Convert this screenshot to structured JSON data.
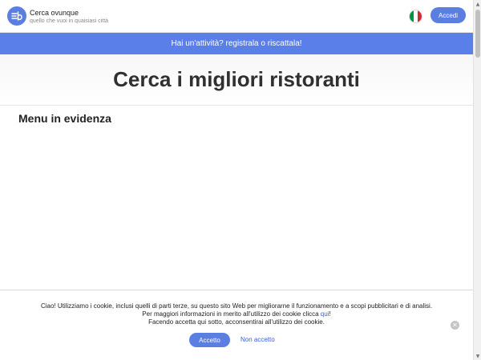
{
  "header": {
    "logo_icon": "fork-knife-logo-icon",
    "search_title": "Cerca ovunque",
    "search_subtitle": "quello che vuoi in quaisiasi città",
    "language_flag": "italy-flag-icon",
    "flag_colors": [
      "#009246",
      "#ffffff",
      "#ce2b37"
    ],
    "login_label": "Accedi"
  },
  "banner": {
    "text": "Hai un'attività? registrala o riscattala!"
  },
  "hero": {
    "title": "Cerca i migliori ristoranti"
  },
  "main": {
    "section_title": "Menu in evidenza"
  },
  "cookie_banner": {
    "line1": "Ciao! Utilizziamo i cookie, inclusi quelli di parti terze, su questo sito Web per migliorarne il funzionamento e a scopi pubblicitari e di analisi.",
    "line2_before": "Per maggiori informazioni in merito all'utilizzo dei cookie clicca ",
    "line2_link": "qui",
    "line2_after": "!",
    "line3": "Facendo accetta qui sotto, acconsentirai all'utilizzo dei cookie.",
    "accept_label": "Accetto",
    "decline_label": "Non accetto",
    "close_icon": "close-icon"
  },
  "colors": {
    "accent": "#5b7fe0",
    "banner_bg": "#5b7fe8",
    "link": "#3b5bdb"
  }
}
